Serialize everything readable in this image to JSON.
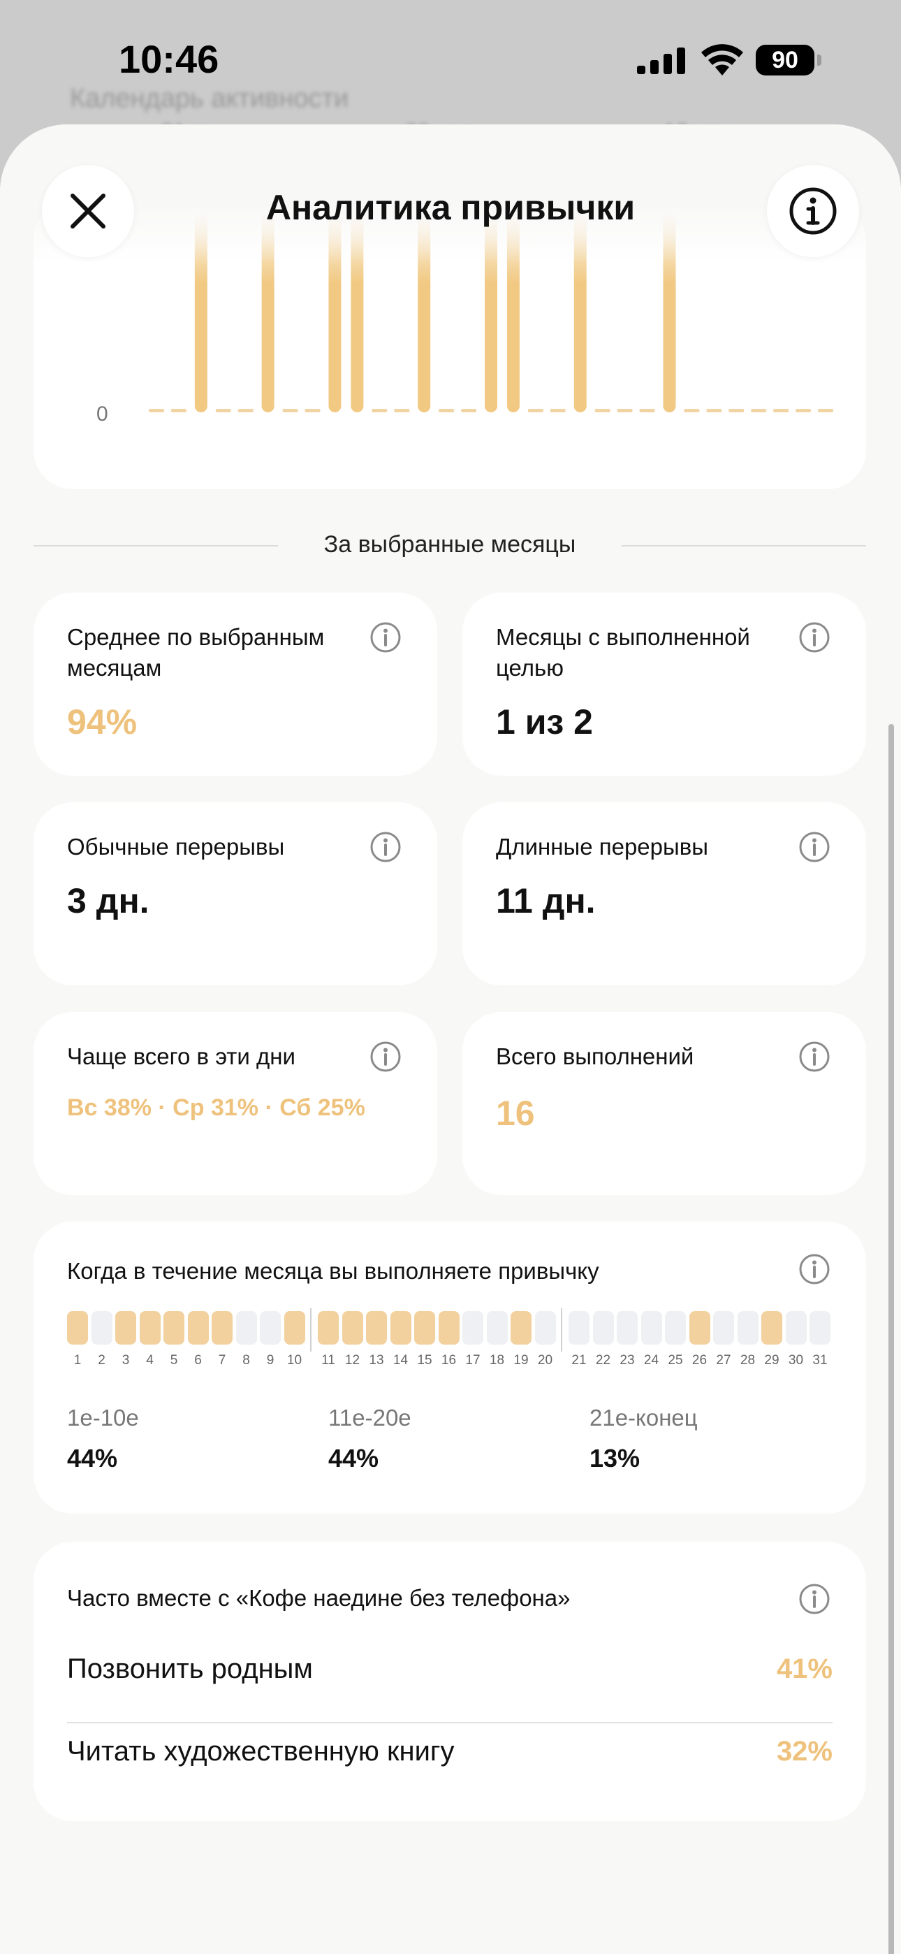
{
  "status": {
    "time": "10:46",
    "battery": "90"
  },
  "background": {
    "line1": "Календарь активности",
    "line2": "21 дн.",
    "line3": "20 нед.",
    "line4": "12 мес."
  },
  "header": {
    "title": "Аналитика привычки"
  },
  "chart_data": {
    "type": "bar",
    "y_tick_labels": [
      "0"
    ],
    "x": [
      1,
      2,
      3,
      4,
      5,
      6,
      7,
      8,
      9,
      10,
      11,
      12,
      13,
      14,
      15,
      16,
      17,
      18,
      19,
      20,
      21,
      22,
      23,
      24,
      25,
      26,
      27,
      28,
      29,
      30,
      31
    ],
    "values": [
      0,
      0,
      1,
      0,
      0,
      1,
      0,
      0,
      1,
      1,
      0,
      0,
      1,
      0,
      0,
      1,
      1,
      0,
      0,
      1,
      0,
      0,
      0,
      1,
      0,
      0,
      0,
      0,
      0,
      0,
      0
    ],
    "ylim": [
      0,
      1
    ],
    "grid": false,
    "colors": {
      "bar": "#f1c983",
      "baseline": "#f1d4a4"
    }
  },
  "section": {
    "label": "За выбранные месяцы"
  },
  "stats": [
    {
      "label": "Среднее по выбранным месяцам",
      "value": "94%"
    },
    {
      "label": "Месяцы с выполненной целью",
      "value": "1 из 2"
    },
    {
      "label": "Обычные перерывы",
      "value": "3 дн."
    },
    {
      "label": "Длинные перерывы",
      "value": "11 дн."
    },
    {
      "label": "Чаще всего в эти дни",
      "value": "Вс 38% · Ср 31% · Сб 25%"
    },
    {
      "label": "Всего выполнений",
      "value": "16"
    }
  ],
  "month_distribution": {
    "title": "Когда в течение месяца вы выполняете привычку",
    "days": [
      1,
      2,
      3,
      4,
      5,
      6,
      7,
      8,
      9,
      10,
      11,
      12,
      13,
      14,
      15,
      16,
      17,
      18,
      19,
      20,
      21,
      22,
      23,
      24,
      25,
      26,
      27,
      28,
      29,
      30,
      31
    ],
    "done": [
      1,
      3,
      4,
      5,
      6,
      7,
      10,
      11,
      12,
      13,
      14,
      15,
      16,
      19,
      26,
      29
    ],
    "ranges": [
      {
        "label": "1е-10е",
        "value": "44%"
      },
      {
        "label": "11е-20е",
        "value": "44%"
      },
      {
        "label": "21е-конец",
        "value": "13%"
      }
    ]
  },
  "together": {
    "title": "Часто вместе с «Кофе наедине без телефона»",
    "items": [
      {
        "name": "Позвонить родным",
        "pct": "41%"
      },
      {
        "name": "Читать художественную книгу",
        "pct": "32%"
      }
    ]
  },
  "colors": {
    "accent": "#eec27c",
    "card": "#ffffff",
    "sheet": "#f8f8f7"
  }
}
